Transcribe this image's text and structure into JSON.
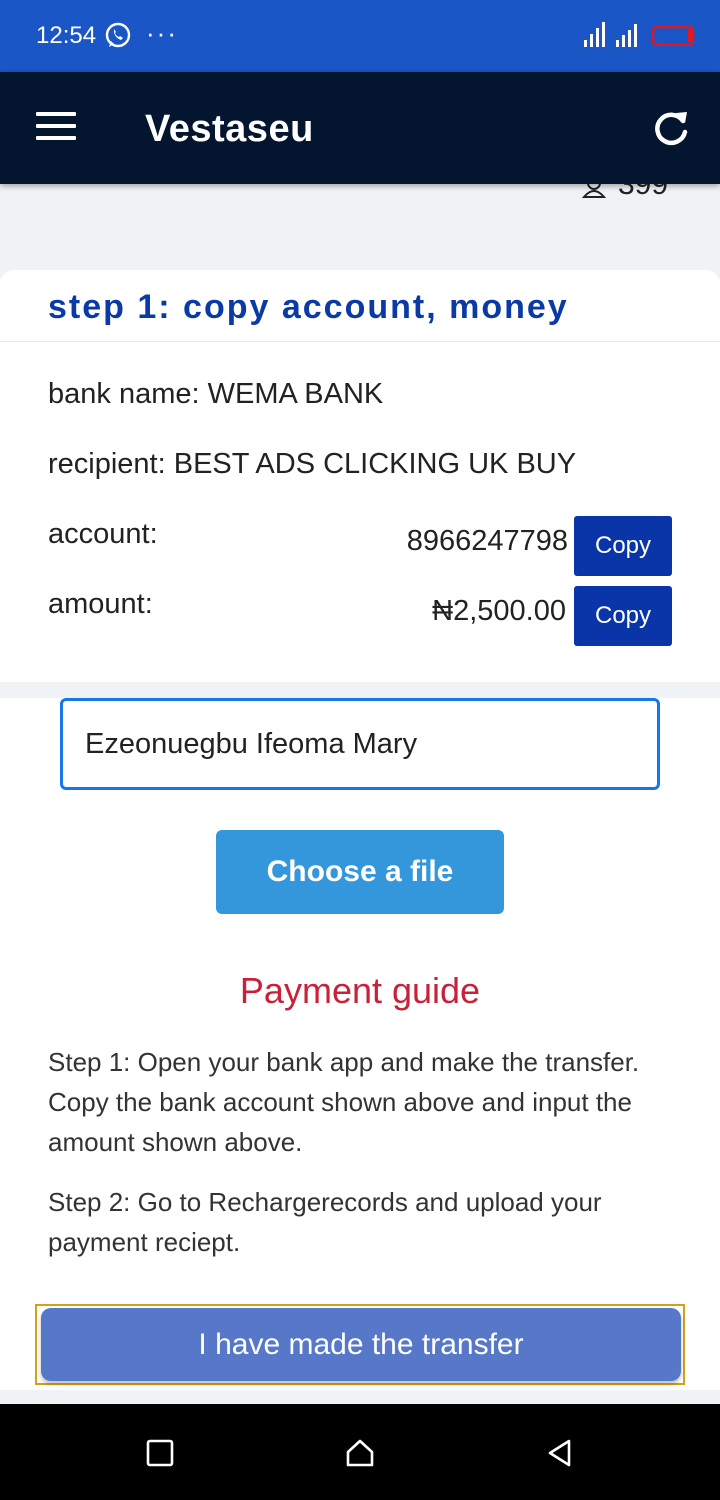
{
  "status_bar": {
    "time": "12:54",
    "dots": "···"
  },
  "app_bar": {
    "title": "Vestaseu"
  },
  "user_count": "399",
  "card": {
    "heading": "step 1: copy account, money",
    "bank_name": "bank name: WEMA BANK",
    "recipient": "recipient: BEST ADS CLICKING UK BUY",
    "account_label": "account:",
    "account_value": "8966247798",
    "amount_label": "amount:",
    "amount_value": "₦2,500.00",
    "copy_label": "Copy"
  },
  "form": {
    "name_value": "Ezeonuegbu Ifeoma Mary",
    "choose_file_label": "Choose a file"
  },
  "guide": {
    "title": "Payment guide",
    "step1": "Step 1: Open your bank app and make the transfer. Copy the bank account shown above and input the amount shown above.",
    "step2": "Step 2: Go to Rechargerecords and upload your payment reciept."
  },
  "submit_label": "I have made the transfer",
  "colors": {
    "status_bar": "#1a56c6",
    "app_bar": "#03152f",
    "heading": "#0a3aa6",
    "copy_button": "#0a35a8",
    "file_button": "#3497dc",
    "guide_title": "#c8213a",
    "submit_button": "#5778c8"
  }
}
